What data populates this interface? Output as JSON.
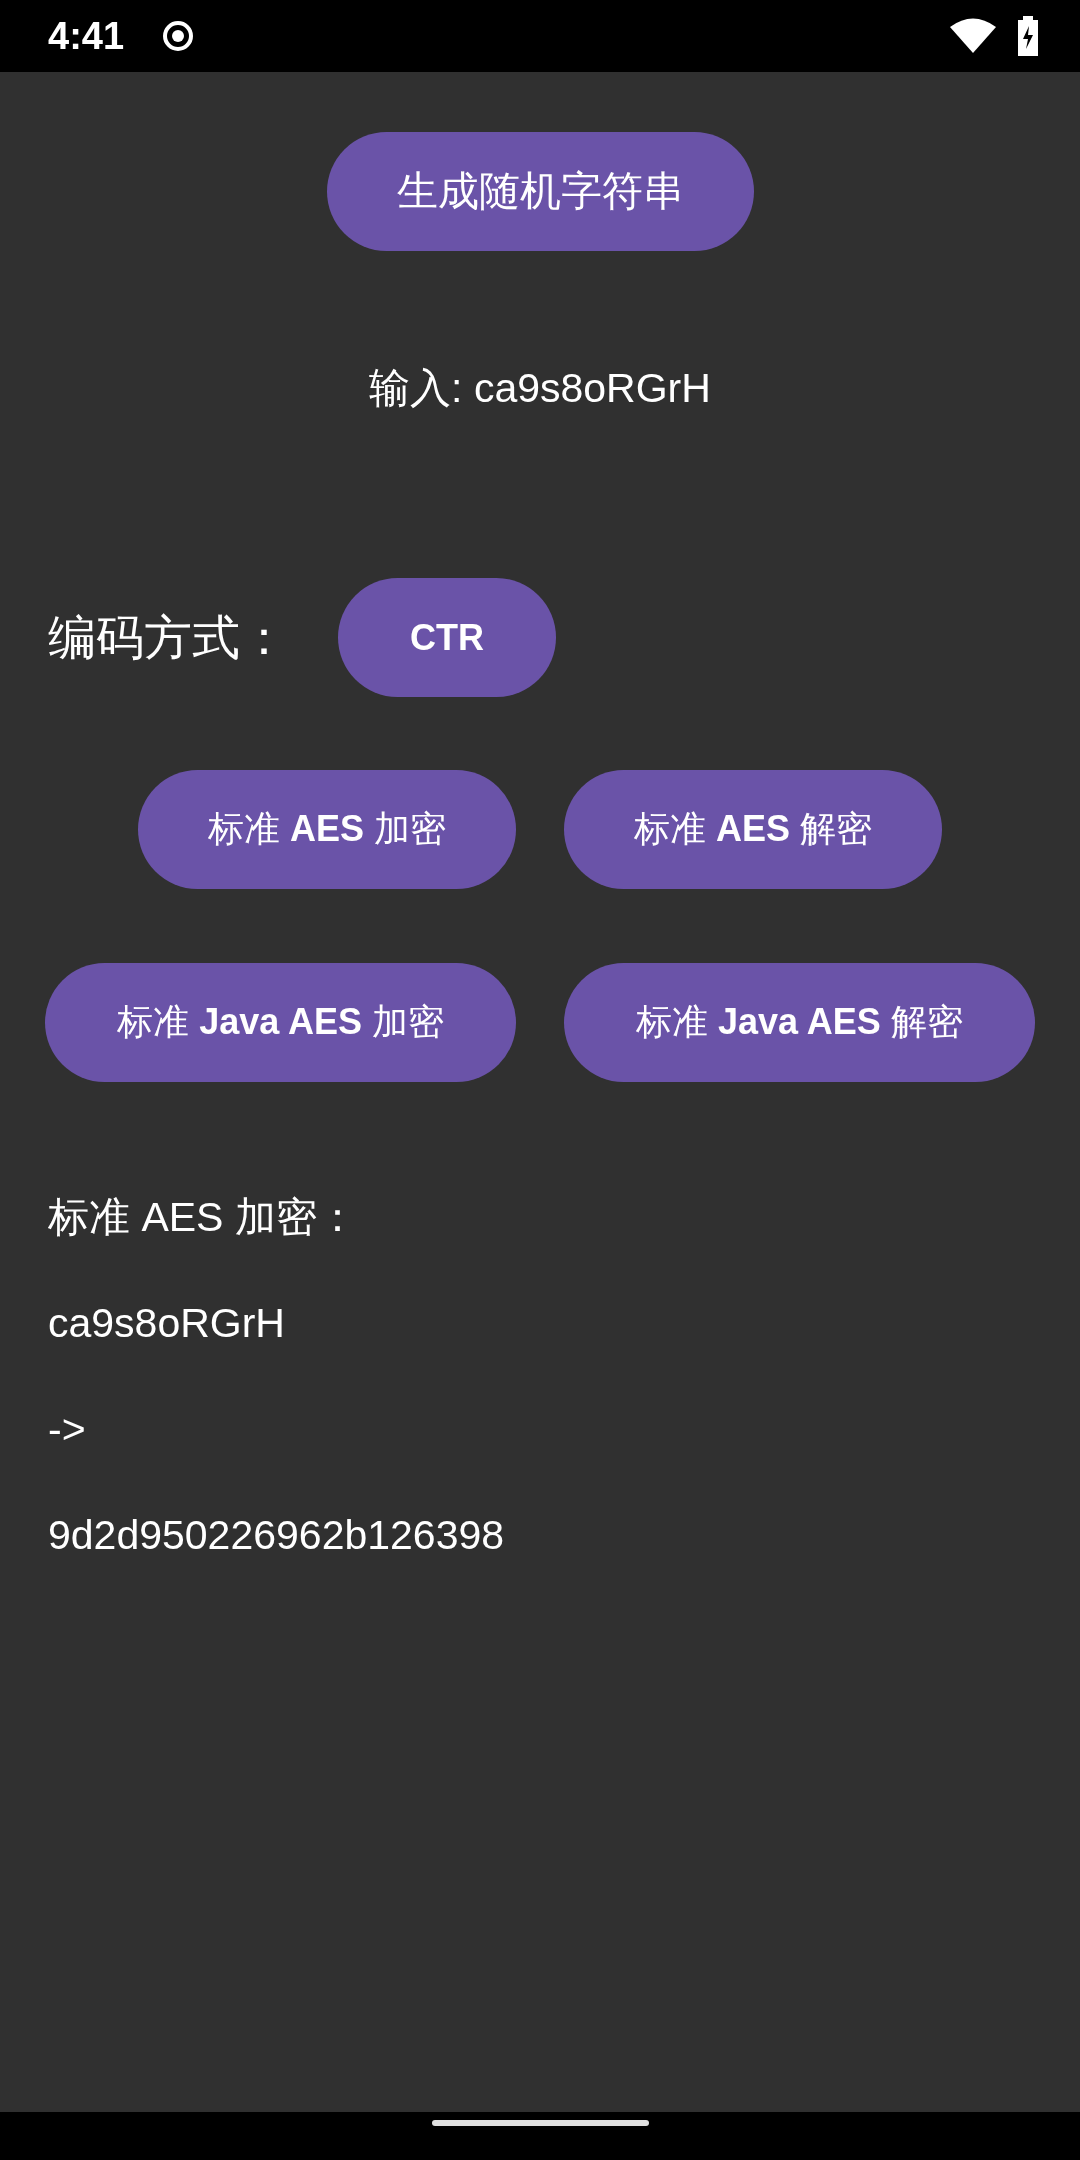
{
  "status_bar": {
    "time": "4:41"
  },
  "generate_button": {
    "label": "生成随机字符串"
  },
  "input_line": "输入: ca9s8oRGrH",
  "mode": {
    "label": "编码方式：",
    "button": "CTR"
  },
  "action_rows": [
    [
      {
        "label": "标准 **AES** 加密"
      },
      {
        "label": "标准 **AES** 解密"
      }
    ],
    [
      {
        "label": "标准 **Java AES** 加密"
      },
      {
        "label": "标准 **Java AES** 解密"
      }
    ]
  ],
  "output_lines": [
    "标准 AES 加密：",
    "ca9s8oRGrH",
    "->",
    "9d2d950226962b126398"
  ]
}
